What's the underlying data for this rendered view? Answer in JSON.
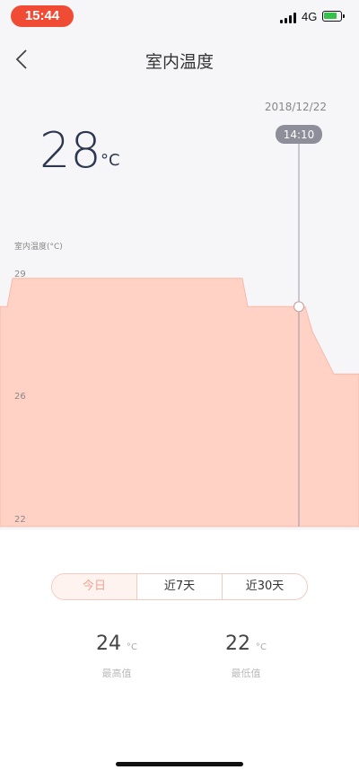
{
  "status_bar": {
    "time": "15:44",
    "network": "4G"
  },
  "header": {
    "title": "室内温度"
  },
  "current": {
    "date": "2018/12/22",
    "time_label": "14:10",
    "value": "28",
    "unit": "°C"
  },
  "chart_data": {
    "type": "area",
    "ylabel": "室内温度(°C)",
    "y_ticks": [
      "29",
      "26",
      "22"
    ],
    "ylim": [
      22,
      29.5
    ],
    "series": [
      {
        "values": [
          28.2,
          28.2,
          29.0,
          29.0,
          29.0,
          28.2,
          28.2,
          28.2,
          27.5,
          27.0,
          26.3,
          26.3
        ]
      }
    ],
    "colors": {
      "fill": "#ffd2c5",
      "stroke": "#f8b8a8",
      "cursor": "#999aa5"
    }
  },
  "tabs": [
    {
      "label": "今日",
      "active": true
    },
    {
      "label": "近7天",
      "active": false
    },
    {
      "label": "近30天",
      "active": false
    }
  ],
  "stats": {
    "max": {
      "value": "24",
      "unit": "°C",
      "label": "最高值"
    },
    "min": {
      "value": "22",
      "unit": "°C",
      "label": "最低值"
    }
  }
}
